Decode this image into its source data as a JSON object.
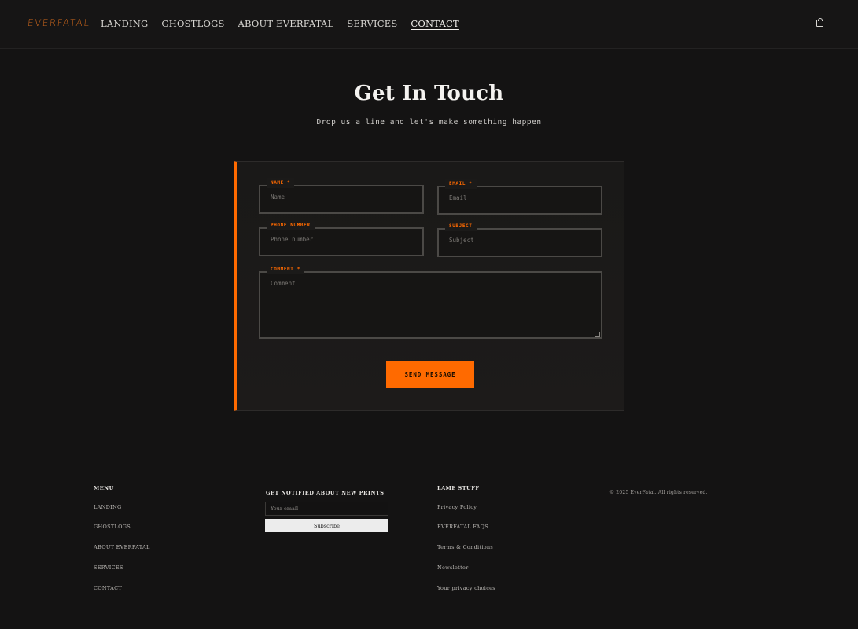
{
  "header": {
    "logo": "EVERFATAL",
    "nav": [
      {
        "label": "LANDING"
      },
      {
        "label": "GHOSTLOGS"
      },
      {
        "label": "ABOUT EVERFATAL"
      },
      {
        "label": "SERVICES"
      },
      {
        "label": "CONTACT",
        "active": true
      }
    ],
    "cart_icon": "shopping-bag-icon"
  },
  "hero": {
    "title": "Get In Touch",
    "subtitle": "Drop us a line and let's make something happen"
  },
  "form": {
    "accent_color": "#ff6a00",
    "fields": {
      "name": {
        "label": "NAME *",
        "placeholder": "Name"
      },
      "email": {
        "label": "EMAIL *",
        "placeholder": "Email"
      },
      "phone": {
        "label": "PHONE NUMBER",
        "placeholder": "Phone number"
      },
      "subject": {
        "label": "SUBJECT",
        "placeholder": "Subject"
      },
      "comment": {
        "label": "COMMENT *",
        "placeholder": "Comment"
      }
    },
    "submit_label": "SEND MESSAGE"
  },
  "footer": {
    "menu": {
      "heading": "MENU",
      "links": [
        "LANDING",
        "GHOSTLOGS",
        "ABOUT EVERFATAL",
        "SERVICES",
        "CONTACT"
      ]
    },
    "newsletter": {
      "heading": "GET NOTIFIED ABOUT NEW PRINTS",
      "placeholder": "Your email",
      "button": "Subscribe"
    },
    "lame": {
      "heading": "LAME STUFF",
      "links": [
        "Privacy Policy",
        "EVERFATAL FAQS",
        "Terms & Conditions",
        "Newsletter",
        "Your privacy choices"
      ]
    },
    "copyright": "© 2025 EverFatal. All rights reserved."
  }
}
